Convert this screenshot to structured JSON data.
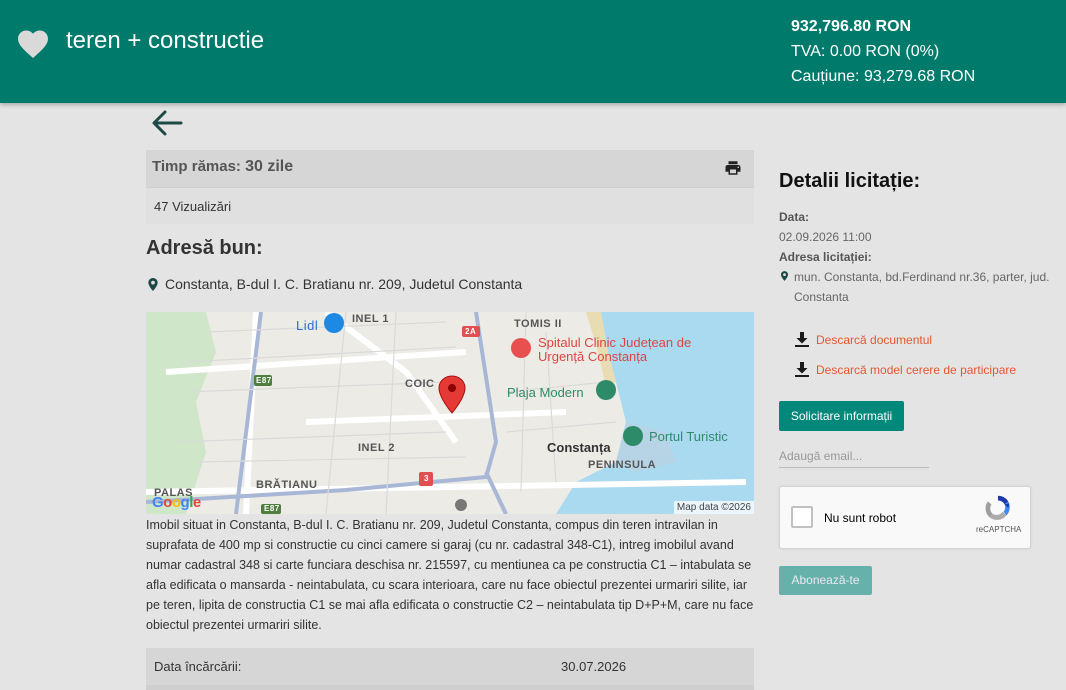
{
  "header": {
    "title": "teren + constructie",
    "price": "932,796.80 RON",
    "tva": "TVA: 0.00 RON (0%)",
    "deposit": "Cauțiune: 93,279.68 RON"
  },
  "time_left": {
    "label": "Timp rămas:",
    "value": "30 zile"
  },
  "views": "47 Vizualizări",
  "address": {
    "heading": "Adresă bun:",
    "text": "Constanta, B-dul I. C. Bratianu nr. 209, Judetul Constanta"
  },
  "map": {
    "labels": {
      "lidl": "Lidl",
      "inel1": "INEL 1",
      "tomis": "TOMIS II",
      "r2a": "2A",
      "hospital": "Spitalul Clinic Județean de Urgență Constanța",
      "e87a": "E87",
      "coic": "COIC",
      "plaja": "Plaja Modern",
      "portul": "Portul Turistic",
      "inel2": "INEL 2",
      "constanta": "Constanța",
      "peninsula": "PENINSULA",
      "r3": "3",
      "palas": "PALAS",
      "bratianu": "BRĂTIANU",
      "e87b": "E87"
    },
    "google": "Google",
    "attribution": "Map data ©2026"
  },
  "description": "Imobil situat in Constanta, B-dul I. C. Bratianu nr. 209, Judetul Constanta, compus din teren intravilan in suprafata de 400 mp si constructie cu cinci camere si garaj (cu nr. cadastral 348-C1), intreg imobilul avand numar cadastral 348 si carte funciara deschisa nr. 215597, cu mentiunea ca pe constructia C1 – intabulata se afla edificata o mansarda - neintabulata, cu scara interioara, care nu face obiectul prezentei urmariri silite, iar pe teren, lipita de constructia C1 se mai afla edificata o constructie C2 – neintabulata tip D+P+M, care nu face obiectul prezentei urmariri silite.",
  "upload": {
    "label": "Data încărcării:",
    "value": "30.07.2026"
  },
  "details": {
    "heading": "Detalii licitație:",
    "date_label": "Data:",
    "date_value": "02.09.2026 11:00",
    "address_label": "Adresa licitației:",
    "address_value": "mun. Constanta, bd.Ferdinand nr.36, parter, jud. Constanta"
  },
  "downloads": {
    "doc": "Descarcă documentul",
    "model": "Descarcă model cerere de participare"
  },
  "request_button": "Solicitare informații",
  "email_placeholder": "Adaugă email...",
  "captcha": {
    "label": "Nu sunt robot",
    "brand": "reCAPTCHA"
  },
  "subscribe_button": "Abonează-te",
  "colors": {
    "header": "#007a6b",
    "accent": "#00897b",
    "link": "#e4572e"
  },
  "icons": [
    "heart-icon",
    "arrow-left-icon",
    "printer-icon",
    "map-marker-icon",
    "download-icon",
    "recaptcha-icon"
  ]
}
